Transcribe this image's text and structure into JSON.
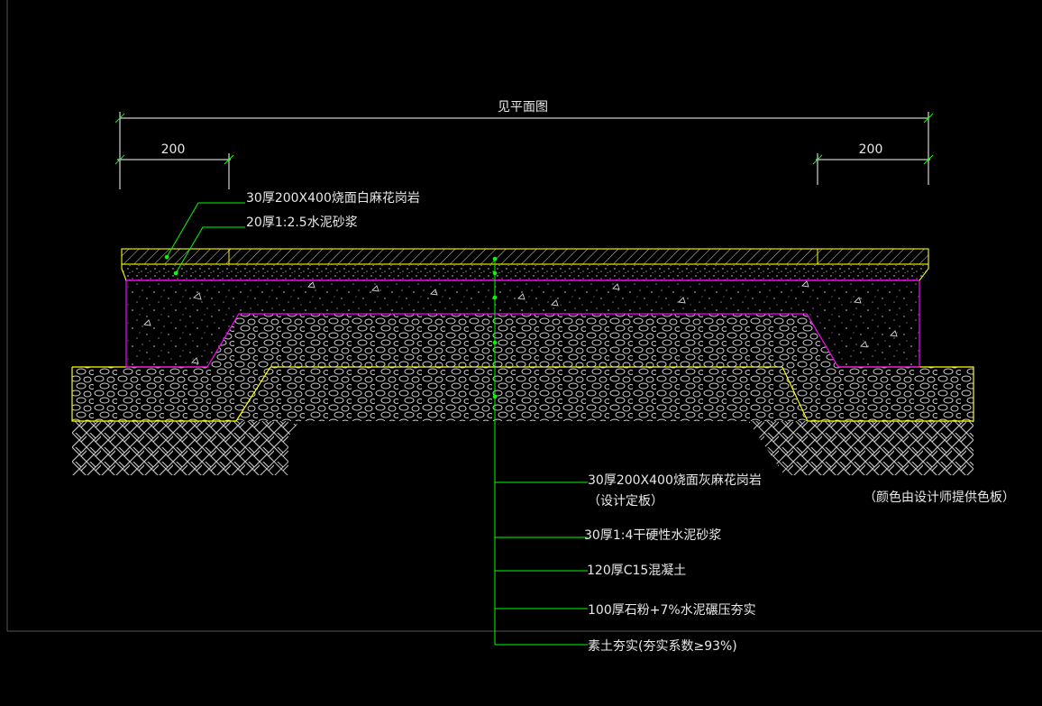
{
  "drawing": {
    "top_dimension_label": "见平面图",
    "left_dimension_value": "200",
    "right_dimension_value": "200"
  },
  "top_labels": {
    "granite_left": "30厚200X400烧面白麻花岗岩",
    "mortar_left": "20厚1:2.5水泥砂浆"
  },
  "layer_labels": {
    "granite": "30厚200X400烧面灰麻花岗岩",
    "granite_note": "（设计定板）",
    "dry_mortar": "30厚1:4干硬性水泥砂浆",
    "concrete": "120厚C15混凝土",
    "stone_base": "100厚石粉+7%水泥碾压夯实",
    "soil": "素土夯实(夯实系数≥93%)"
  },
  "side_note": "（颜色由设计师提供色板）",
  "colors": {
    "background": "#000000",
    "leader_green": "#00ff00",
    "outline_yellow": "#ffff00",
    "outline_magenta": "#ff00ff",
    "dimension_white": "#ffffff",
    "hatch_gray": "#c8c8c8"
  }
}
